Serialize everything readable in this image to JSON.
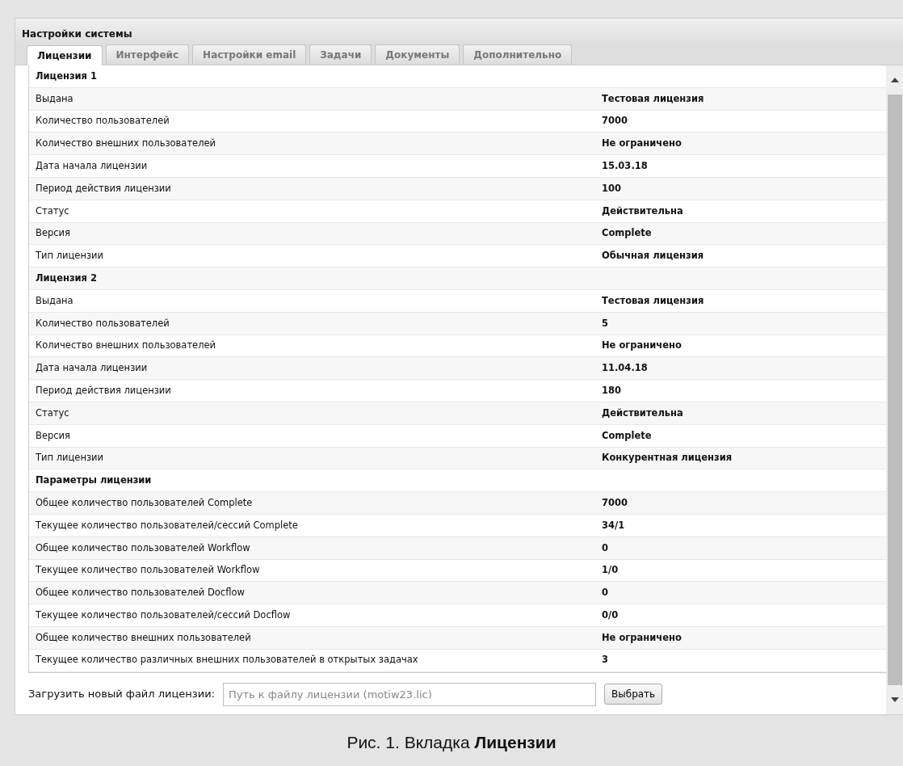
{
  "window": {
    "title": "Настройки системы"
  },
  "tabs": [
    {
      "label": "Лицензии",
      "selected": true
    },
    {
      "label": "Интерфейс",
      "selected": false
    },
    {
      "label": "Настройки email",
      "selected": false
    },
    {
      "label": "Задачи",
      "selected": false
    },
    {
      "label": "Документы",
      "selected": false
    },
    {
      "label": "Дополнительно",
      "selected": false
    }
  ],
  "sections": [
    {
      "title": "Лицензия 1",
      "rows": [
        {
          "label": "Выдана",
          "value": "Тестовая лицензия"
        },
        {
          "label": "Количество пользователей",
          "value": "7000"
        },
        {
          "label": "Количество внешних пользователей",
          "value": "Не ограничено"
        },
        {
          "label": "Дата начала лицензии",
          "value": "15.03.18"
        },
        {
          "label": "Период действия лицензии",
          "value": "100"
        },
        {
          "label": "Статус",
          "value": "Действительна"
        },
        {
          "label": "Версия",
          "value": "Complete"
        },
        {
          "label": "Тип лицензии",
          "value": "Обычная лицензия"
        }
      ]
    },
    {
      "title": "Лицензия 2",
      "rows": [
        {
          "label": "Выдана",
          "value": "Тестовая лицензия"
        },
        {
          "label": "Количество пользователей",
          "value": "5"
        },
        {
          "label": "Количество внешних пользователей",
          "value": "Не ограничено"
        },
        {
          "label": "Дата начала лицензии",
          "value": "11.04.18"
        },
        {
          "label": "Период действия лицензии",
          "value": "180"
        },
        {
          "label": "Статус",
          "value": "Действительна"
        },
        {
          "label": "Версия",
          "value": "Complete"
        },
        {
          "label": "Тип лицензии",
          "value": "Конкурентная лицензия"
        }
      ]
    },
    {
      "title": "Параметры лицензии",
      "rows": [
        {
          "label": "Общее количество пользователей Complete",
          "value": "7000"
        },
        {
          "label": "Текущее количество пользователей/сессий Complete",
          "value": "34/1"
        },
        {
          "label": "Общее количество пользователей Workflow",
          "value": "0"
        },
        {
          "label": "Текущее количество пользователей Workflow",
          "value": "1/0"
        },
        {
          "label": "Общее количество пользователей Docflow",
          "value": "0"
        },
        {
          "label": "Текущее количество пользователей/сессий Docflow",
          "value": "0/0"
        },
        {
          "label": "Общее количество внешних пользователей",
          "value": "Не ограничено"
        },
        {
          "label": "Текущее количество различных внешних пользователей в открытых задачах",
          "value": "3"
        }
      ]
    }
  ],
  "upload": {
    "label": "Загрузить новый файл лицензии:",
    "placeholder": "Путь к файлу лицензии (motiw23.lic)",
    "button": "Выбрать"
  },
  "caption": "Рис. 1. Вкладка **Лицензии**"
}
